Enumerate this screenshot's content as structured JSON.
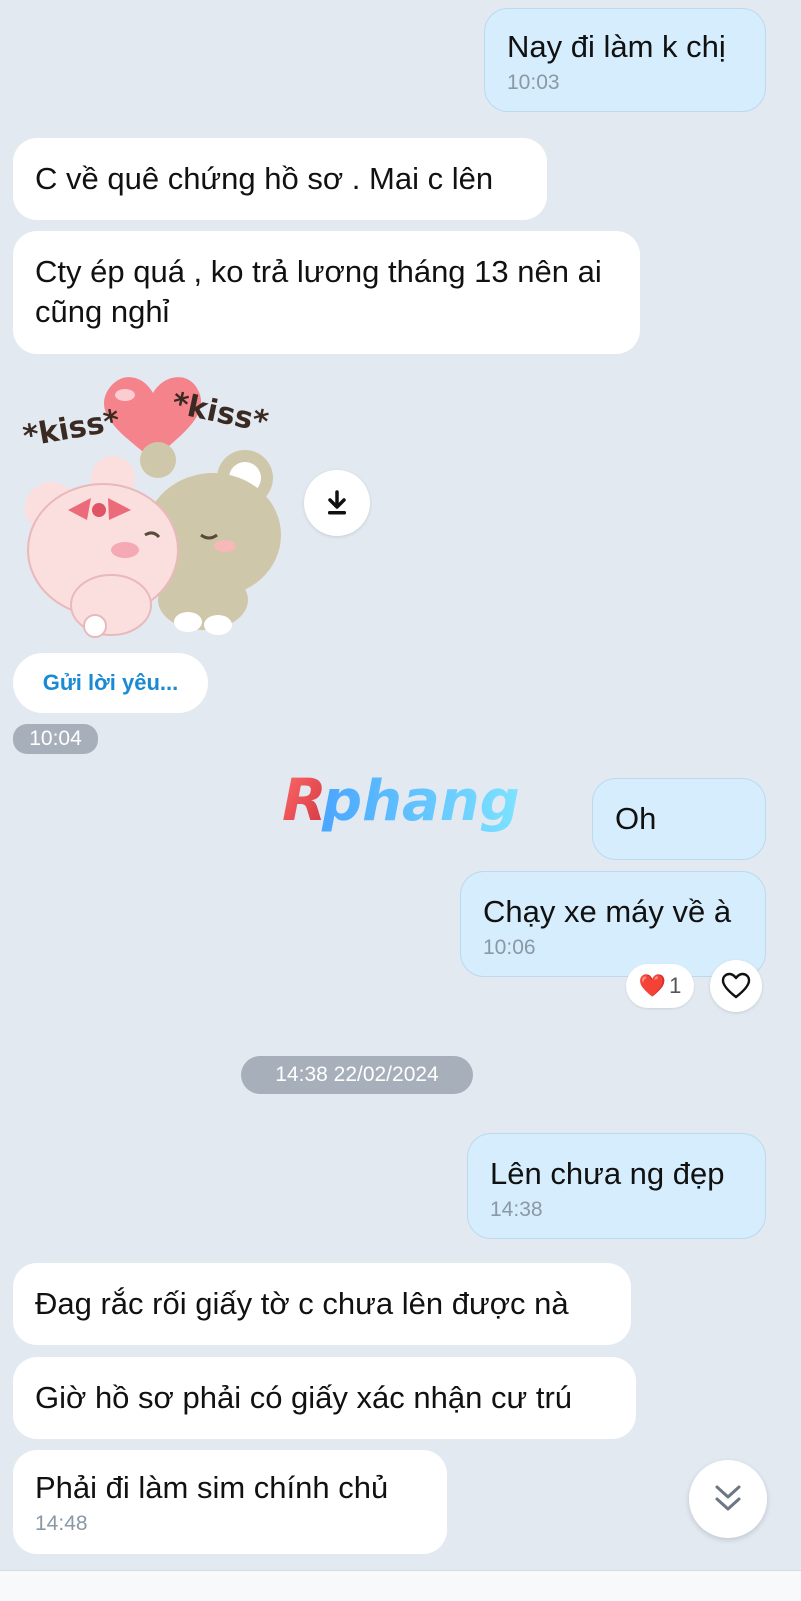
{
  "messages": [
    {
      "direction": "out",
      "text": "Nay đi làm k chị",
      "time": "10:03"
    },
    {
      "direction": "in",
      "text": "C về quê chứng hồ sơ . Mai c lên",
      "time": ""
    },
    {
      "direction": "in",
      "text": "Cty ép quá , ko trả lương tháng 13 nên ai cũng nghỉ",
      "time": ""
    },
    {
      "direction": "in",
      "type": "sticker",
      "sticker_text": "*kiss* *kiss*",
      "time": "10:04"
    },
    {
      "direction": "out",
      "text": "Oh",
      "time": ""
    },
    {
      "direction": "out",
      "text": "Chạy xe máy về à",
      "time": "10:06",
      "reaction": {
        "emoji": "❤️",
        "count": "1"
      }
    },
    {
      "direction": "out",
      "text": "Lên chưa ng đẹp",
      "time": "14:38"
    },
    {
      "direction": "in",
      "text": "Đag rắc rối giấy tờ c chưa lên được nà",
      "time": ""
    },
    {
      "direction": "in",
      "text": "Giờ hồ sơ phải có giấy xác nhận cư trú",
      "time": ""
    },
    {
      "direction": "in",
      "text": "Phải đi làm sim chính chủ",
      "time": "14:48"
    }
  ],
  "sticker_suggestion": "Gửi lời yêu...",
  "date_separator": "14:38 22/02/2024",
  "watermark": "Rphang",
  "icons": {
    "download": "download-icon",
    "heart_outline": "heart-outline-icon",
    "scroll_down": "double-chevron-down-icon"
  },
  "colors": {
    "background": "#e2e9f1",
    "incoming_bubble": "#ffffff",
    "outgoing_bubble": "#d5edfc",
    "accent": "#1a8ad4",
    "timestamp": "#8b98a5"
  }
}
